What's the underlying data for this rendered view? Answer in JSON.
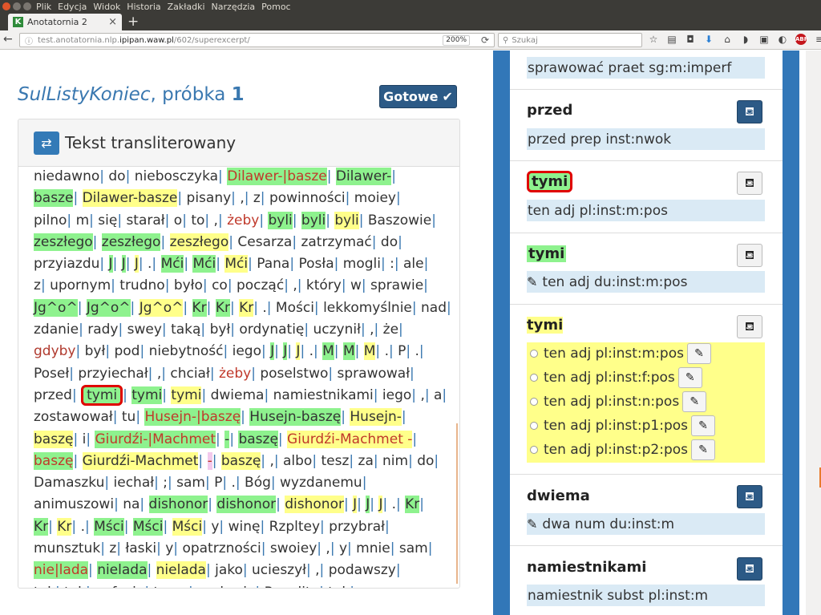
{
  "browser": {
    "menu": [
      "Plik",
      "Edycja",
      "Widok",
      "Historia",
      "Zakładki",
      "Narzędzia",
      "Pomoc"
    ],
    "tab_title": "Anotatornia 2",
    "tab_favicon": "K",
    "url_domain": "test.anotatornia.nlp.ipipan.waw.pl",
    "url_path": "/602/superexcerpt/",
    "url_prefix": "test.anotatornia.nlp.",
    "url_domain_bold": "ipipan.waw.pl",
    "zoom": "200%",
    "search_placeholder": "Szukaj"
  },
  "page": {
    "title_italic": "SulListyKoniec",
    "title_rest": ", próbka ",
    "title_num": "1",
    "done_label": "Gotowe",
    "panel_title": "Tekst transliterowany"
  },
  "text_lines": [
    [
      [
        "niedawno",
        ""
      ],
      [
        "do",
        ""
      ],
      [
        "niebosczyka",
        ""
      ],
      [
        "Dilawer-|basze",
        "g red"
      ],
      [
        "Dilawer-",
        "g"
      ]
    ],
    [
      [
        "basze",
        "g"
      ],
      [
        "Dilawer-basze",
        "y"
      ],
      [
        "pisany",
        ""
      ],
      [
        ",",
        ""
      ],
      [
        "z",
        ""
      ],
      [
        "powinności",
        ""
      ],
      [
        "moiey",
        ""
      ]
    ],
    [
      [
        "pilno",
        ""
      ],
      [
        "m",
        ""
      ],
      [
        "się",
        ""
      ],
      [
        "starał",
        ""
      ],
      [
        "o",
        ""
      ],
      [
        "to",
        ""
      ],
      [
        ",",
        ""
      ],
      [
        "żeby",
        "red"
      ],
      [
        "byli",
        "g"
      ],
      [
        "byli",
        "g"
      ],
      [
        "byli",
        "y"
      ],
      [
        "Baszowie",
        ""
      ]
    ],
    [
      [
        "zeszłego",
        "g"
      ],
      [
        "zeszłego",
        "g"
      ],
      [
        "zeszłego",
        "y"
      ],
      [
        "Cesarza",
        ""
      ],
      [
        "zatrzymać",
        ""
      ],
      [
        "do",
        ""
      ]
    ],
    [
      [
        "przyiazdu",
        ""
      ],
      [
        "J",
        "g"
      ],
      [
        "J",
        "g"
      ],
      [
        "J",
        "y"
      ],
      [
        ".",
        ""
      ],
      [
        "Mći",
        "g"
      ],
      [
        "Mći",
        "g"
      ],
      [
        "Mći",
        "y"
      ],
      [
        "Pana",
        ""
      ],
      [
        "Posła",
        ""
      ],
      [
        "mogli",
        ""
      ],
      [
        ":",
        ""
      ],
      [
        "ale",
        ""
      ]
    ],
    [
      [
        "z",
        ""
      ],
      [
        "upornym",
        ""
      ],
      [
        "trudno",
        ""
      ],
      [
        "było",
        ""
      ],
      [
        "co",
        ""
      ],
      [
        "począć",
        ""
      ],
      [
        ",",
        ""
      ],
      [
        "który",
        ""
      ],
      [
        "w",
        ""
      ],
      [
        "sprawie",
        ""
      ]
    ],
    [
      [
        "Jg^o^",
        "g"
      ],
      [
        "Jg^o^",
        "g"
      ],
      [
        "Jg^o^",
        "y"
      ],
      [
        "Kr",
        "g"
      ],
      [
        "Kr",
        "g"
      ],
      [
        "Kr",
        "y"
      ],
      [
        ".",
        ""
      ],
      [
        "Mości",
        ""
      ],
      [
        "lekkomyślnie",
        ""
      ],
      [
        "nad",
        ""
      ]
    ],
    [
      [
        "zdanie",
        ""
      ],
      [
        "rady",
        ""
      ],
      [
        "swey",
        ""
      ],
      [
        "taką",
        ""
      ],
      [
        "był",
        ""
      ],
      [
        "ordynatię",
        ""
      ],
      [
        "uczynił",
        ""
      ],
      [
        ",",
        ""
      ],
      [
        "że",
        ""
      ]
    ],
    [
      [
        "gdyby",
        "dred"
      ],
      [
        "był",
        ""
      ],
      [
        "pod",
        ""
      ],
      [
        "niebytność",
        ""
      ],
      [
        "iego",
        ""
      ],
      [
        "J",
        "g"
      ],
      [
        "J",
        "g"
      ],
      [
        "J",
        "y"
      ],
      [
        ".",
        ""
      ],
      [
        "M",
        "g"
      ],
      [
        "M",
        "g"
      ],
      [
        "M",
        "y"
      ],
      [
        ".",
        ""
      ],
      [
        "P",
        ""
      ],
      [
        ".",
        ""
      ]
    ],
    [
      [
        "Poseł",
        ""
      ],
      [
        "przyiechał",
        ""
      ],
      [
        ",",
        ""
      ],
      [
        "chciał",
        ""
      ],
      [
        "żeby",
        "red"
      ],
      [
        "poselstwo",
        ""
      ],
      [
        "sprawował",
        ""
      ]
    ],
    [
      [
        "przed",
        ""
      ],
      [
        "tymi",
        "sel"
      ],
      [
        "tymi",
        "g"
      ],
      [
        "tymi",
        "y"
      ],
      [
        "dwiema",
        ""
      ],
      [
        "namiestnikami",
        ""
      ],
      [
        "iego",
        ""
      ],
      [
        ",",
        ""
      ],
      [
        "a",
        ""
      ]
    ],
    [
      [
        "zostawował",
        ""
      ],
      [
        "tu",
        ""
      ],
      [
        "Husejn-|baszę",
        "g red"
      ],
      [
        "Husejn-baszę",
        "g"
      ],
      [
        "Husejn-",
        "y"
      ]
    ],
    [
      [
        "baszę",
        "y"
      ],
      [
        "i",
        ""
      ],
      [
        "Giurdźi-|Machmet",
        "g red"
      ],
      [
        "-",
        "g"
      ],
      [
        "baszę",
        "g"
      ],
      [
        "Giurdźi-Machmet -",
        "y red"
      ]
    ],
    [
      [
        "baszę",
        "g red"
      ],
      [
        "Giurdźi-Machmet",
        "y"
      ],
      [
        "-",
        "p red"
      ],
      [
        "baszę",
        "y"
      ],
      [
        ",",
        ""
      ],
      [
        "albo",
        ""
      ],
      [
        "tesz",
        ""
      ],
      [
        "za",
        ""
      ],
      [
        "nim",
        ""
      ],
      [
        "do",
        ""
      ]
    ],
    [
      [
        "Damaszku",
        ""
      ],
      [
        "iechał",
        ""
      ],
      [
        ";",
        ""
      ],
      [
        "sam",
        ""
      ],
      [
        "P",
        ""
      ],
      [
        ".",
        ""
      ],
      [
        "Bóg",
        ""
      ],
      [
        "wyzdanemu",
        ""
      ]
    ],
    [
      [
        "animuszowi",
        ""
      ],
      [
        "na",
        ""
      ],
      [
        "dishonor",
        "g"
      ],
      [
        "dishonor",
        "g"
      ],
      [
        "dishonor",
        "y"
      ],
      [
        "J",
        "y"
      ],
      [
        "J",
        "g"
      ],
      [
        "J",
        "y"
      ],
      [
        ".",
        ""
      ],
      [
        "Kr",
        "g"
      ]
    ],
    [
      [
        "Kr",
        "g"
      ],
      [
        "Kr",
        "y"
      ],
      [
        ".",
        ""
      ],
      [
        "Mści",
        "g"
      ],
      [
        "Mści",
        "g"
      ],
      [
        "Mści",
        "y"
      ],
      [
        "y",
        ""
      ],
      [
        "winę",
        ""
      ],
      [
        "Rzpltey",
        ""
      ],
      [
        "przybrał",
        ""
      ]
    ],
    [
      [
        "munsztuk",
        ""
      ],
      [
        "z",
        ""
      ],
      [
        "łaski",
        ""
      ],
      [
        "y",
        ""
      ],
      [
        "opatrzności",
        ""
      ],
      [
        "swoiey",
        ""
      ],
      [
        ",",
        ""
      ],
      [
        "y",
        ""
      ],
      [
        "mnie",
        ""
      ],
      [
        "sam",
        ""
      ]
    ],
    [
      [
        "nie|lada",
        "g red"
      ],
      [
        "nielada",
        "g"
      ],
      [
        "nielada",
        "y"
      ],
      [
        "jako",
        ""
      ],
      [
        "ucieszył",
        ""
      ],
      [
        ",",
        ""
      ],
      [
        "podawszy",
        ""
      ]
    ],
    [
      [
        "tak",
        ""
      ],
      [
        "tak",
        ""
      ],
      [
        "pofecie",
        ""
      ],
      [
        "teraz",
        ""
      ],
      [
        "zzakazie",
        ""
      ],
      [
        "Rzeplite",
        ""
      ],
      [
        "tak",
        ""
      ]
    ]
  ],
  "right": {
    "top_row": "sprawować praet sg:m:imperf",
    "entries": [
      {
        "word": "przed",
        "interp": "przed prep inst:nwok"
      },
      {
        "word": "tymi",
        "interp": "ten adj pl:inst:m:pos"
      },
      {
        "word": "tymi",
        "interp": "ten adj du:inst:m:pos"
      },
      {
        "word": "tymi",
        "options": [
          "ten adj pl:inst:m:pos",
          "ten adj pl:inst:f:pos",
          "ten adj pl:inst:n:pos",
          "ten adj pl:inst:p1:pos",
          "ten adj pl:inst:p2:pos"
        ]
      },
      {
        "word": "dwiema",
        "interp": "dwa num du:inst:m"
      },
      {
        "word": "namiestnikami",
        "interp": "namiestnik subst pl:inst:m"
      }
    ]
  },
  "icons": {
    "translit": "swap-arrows-icon",
    "stamp": "stamp-icon",
    "pencil": "pencil-icon",
    "check": "check-icon"
  },
  "colors": {
    "accent_blue": "#3277b8",
    "green_mark": "#8ef28e",
    "yellow_mark": "#ffff8a",
    "selection_red": "#e00000"
  }
}
